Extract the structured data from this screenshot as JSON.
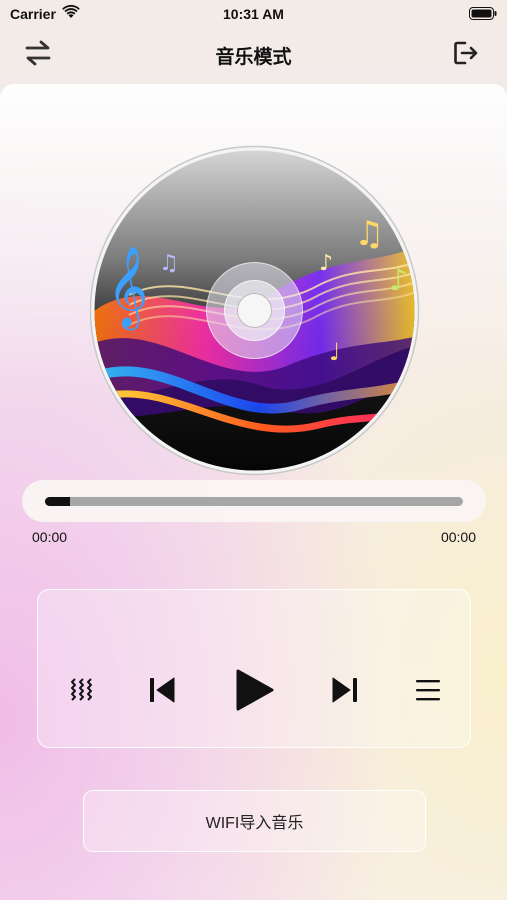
{
  "status_bar": {
    "carrier": "Carrier",
    "time": "10:31 AM"
  },
  "nav": {
    "title": "音乐模式"
  },
  "player": {
    "progress_fraction": 0.06,
    "elapsed": "00:00",
    "duration": "00:00"
  },
  "controls": {
    "mode_icon": "wave-mode-icon",
    "prev_icon": "skip-previous-icon",
    "play_icon": "play-icon",
    "next_icon": "skip-next-icon",
    "list_icon": "playlist-icon"
  },
  "import_button": {
    "label": "WIFI导入音乐"
  }
}
